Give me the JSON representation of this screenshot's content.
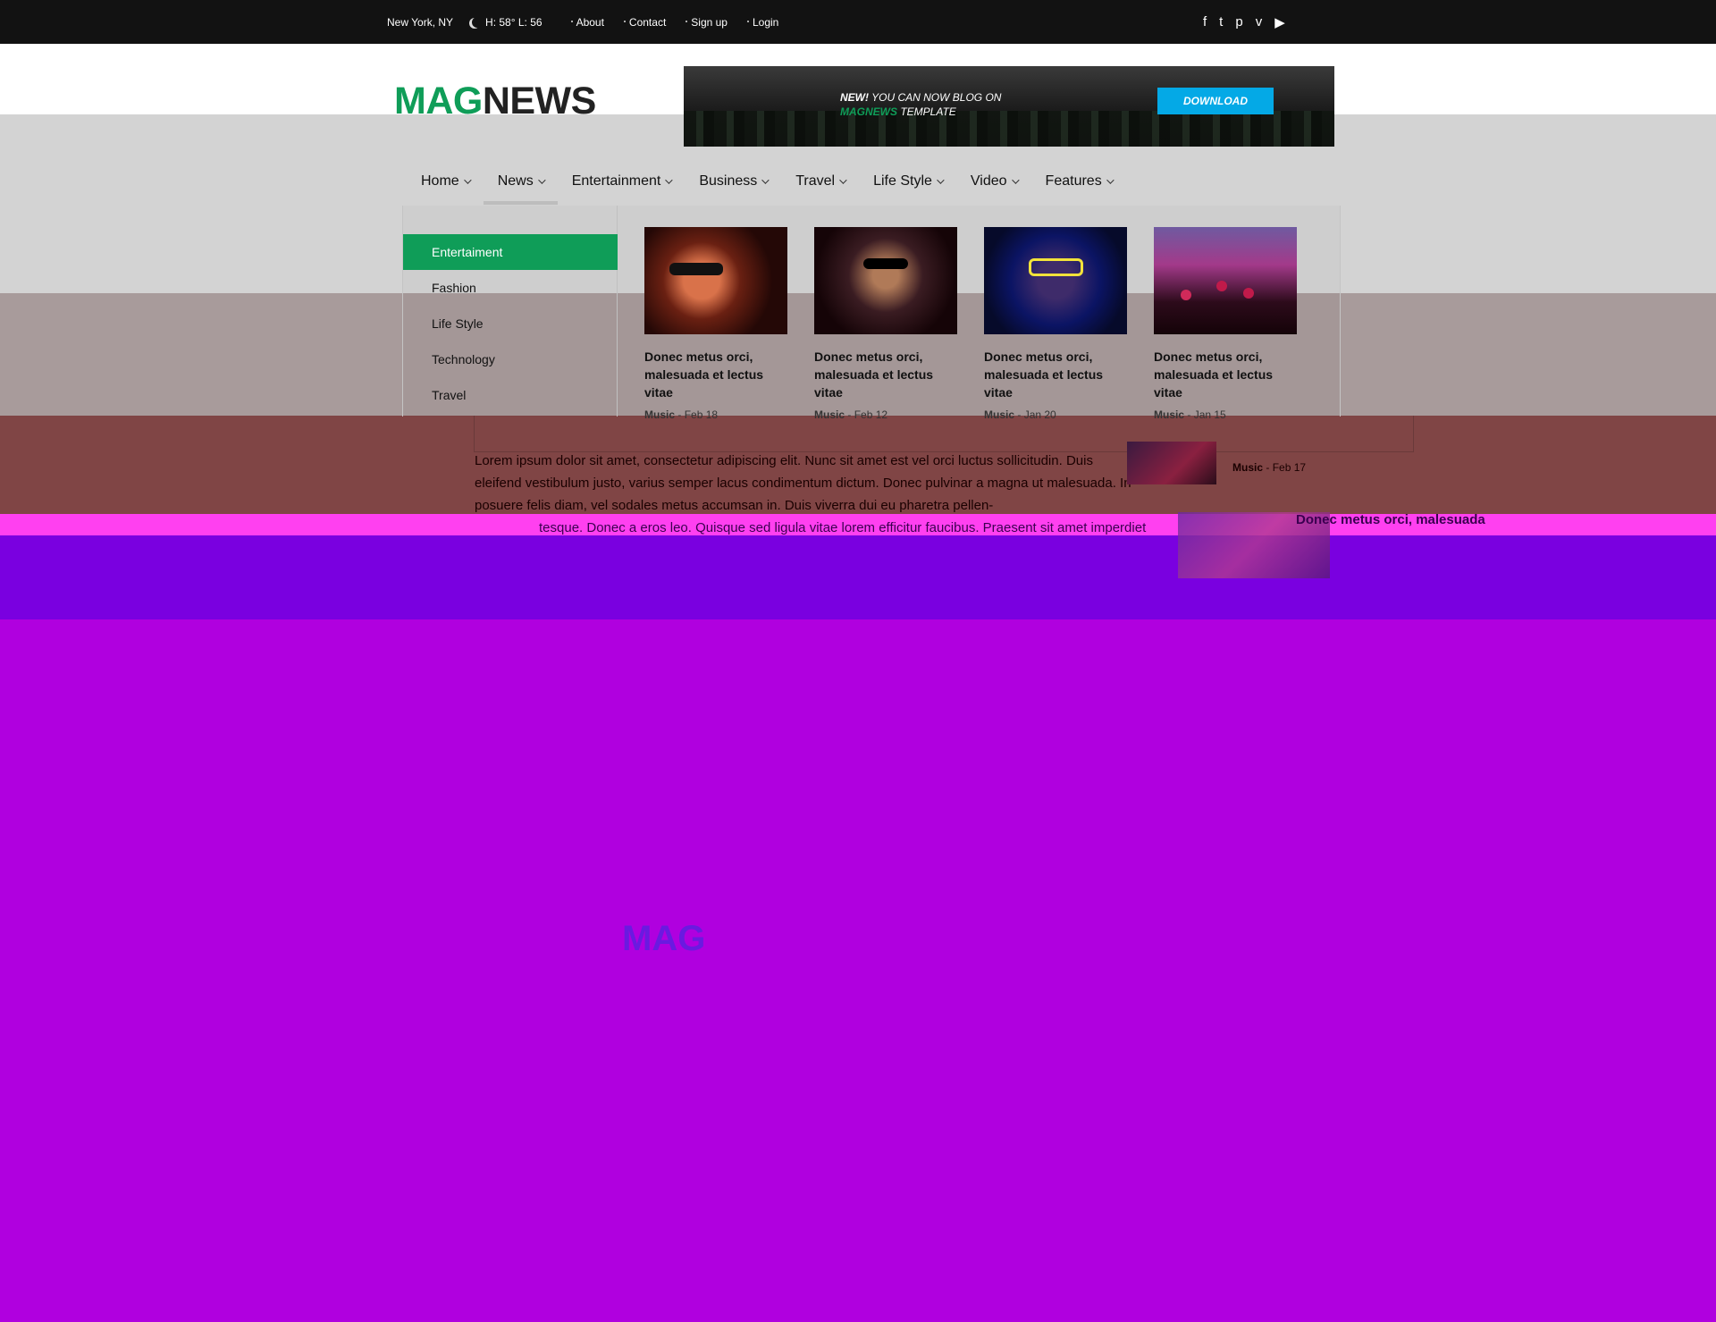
{
  "topbar": {
    "location": "New York, NY",
    "weather": "H: 58° L: 56",
    "links": [
      "About",
      "Contact",
      "Sign up",
      "Login"
    ],
    "social_icons": [
      "facebook-icon",
      "twitter-icon",
      "pinterest-icon",
      "vimeo-icon",
      "youtube-icon"
    ]
  },
  "header": {
    "logo_part1": "MAG",
    "logo_part2": "NEWS",
    "banner": {
      "new_label": "NEW!",
      "text1": " YOU CAN NOW BLOG ON",
      "brand": "MAGNEWS",
      "text2": " TEMPLATE",
      "button": "DOWNLOAD"
    }
  },
  "nav": {
    "items": [
      "Home",
      "News",
      "Entertainment",
      "Business",
      "Travel",
      "Life Style",
      "Video",
      "Features"
    ],
    "active": "News"
  },
  "mega_menu": {
    "categories": [
      "Entertaiment",
      "Fashion",
      "Life Style",
      "Technology",
      "Travel"
    ],
    "active_category": "Entertaiment",
    "posts": [
      {
        "title": "Donec metus orci, malesuada et lectus vitae",
        "category": "Music",
        "date": "Feb 18"
      },
      {
        "title": "Donec metus orci, malesuada et lectus vitae",
        "category": "Music",
        "date": "Feb 12"
      },
      {
        "title": "Donec metus orci, malesuada et lectus vitae",
        "category": "Music",
        "date": "Jan 20"
      },
      {
        "title": "Donec metus orci, malesuada et lectus vitae",
        "category": "Music",
        "date": "Jan 15"
      }
    ]
  },
  "content": {
    "paragraph1": "Lorem ipsum dolor sit amet, consectetur adipiscing elit. Nunc sit amet est vel orci luctus sollicitudin. Duis eleifend vestibulum justo, varius semper lacus condimentum dictum. Donec pulvinar a magna ut malesuada. In posuere felis diam, vel sodales metus accumsan in. Duis viverra dui eu pharetra pellen-",
    "paragraph2": "tesque. Donec a eros leo. Quisque sed ligula vitae lorem efficitur faucibus. Praesent sit amet imperdiet",
    "side_post1": {
      "category": "Music",
      "date": "Feb 17"
    },
    "side_post2": {
      "title": "Donec metus orci, malesuada"
    },
    "footer_logo": "MAG"
  }
}
